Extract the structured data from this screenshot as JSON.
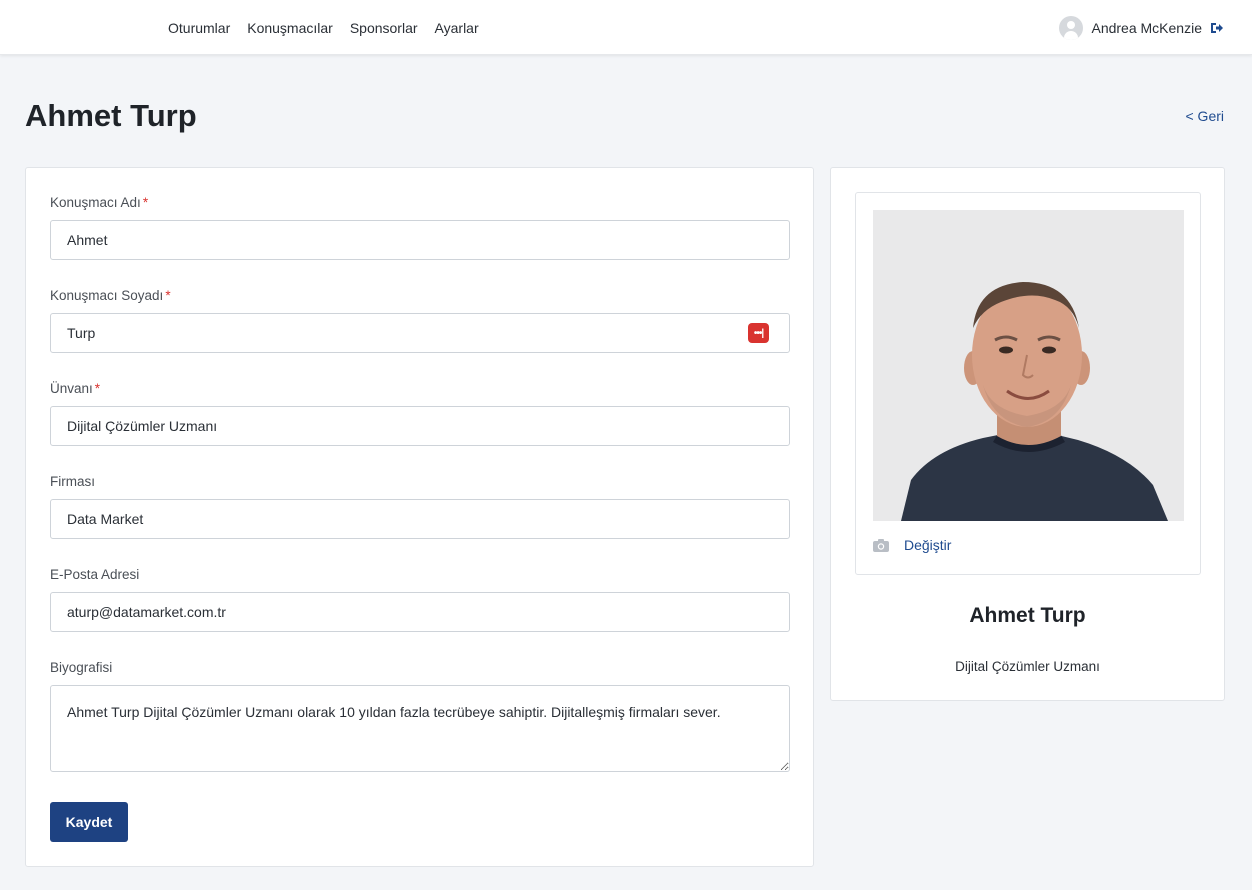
{
  "nav": {
    "items": [
      "Oturumlar",
      "Konuşmacılar",
      "Sponsorlar",
      "Ayarlar"
    ]
  },
  "user": {
    "name": "Andrea McKenzie",
    "avatar_icon": "user-avatar-icon",
    "logout_icon": "logout-icon"
  },
  "page": {
    "title": "Ahmet Turp",
    "back_label": "< Geri"
  },
  "form": {
    "first_name": {
      "label": "Konuşmacı Adı",
      "required": "*",
      "value": "Ahmet"
    },
    "last_name": {
      "label": "Konuşmacı Soyadı",
      "required": "*",
      "value": "Turp"
    },
    "title": {
      "label": "Ünvanı",
      "required": "*",
      "value": "Dijital Çözümler Uzmanı"
    },
    "company": {
      "label": "Firması",
      "value": "Data Market"
    },
    "email": {
      "label": "E-Posta Adresi",
      "value": "aturp@datamarket.com.tr"
    },
    "bio": {
      "label": "Biyografisi",
      "value": "Ahmet Turp Dijital Çözümler Uzmanı olarak 10 yıldan fazla tecrübeye sahiptir. Dijitalleşmiş firmaları sever."
    },
    "save_label": "Kaydet",
    "password_manager_icon": "password-manager-icon"
  },
  "profile": {
    "change_label": "Değiştir",
    "camera_icon": "camera-icon",
    "name": "Ahmet Turp",
    "title": "Dijital Çözümler Uzmanı"
  },
  "colors": {
    "primary": "#1e4282",
    "link": "#1f4b8f",
    "required": "#d9332f",
    "background": "#f3f5f8"
  }
}
